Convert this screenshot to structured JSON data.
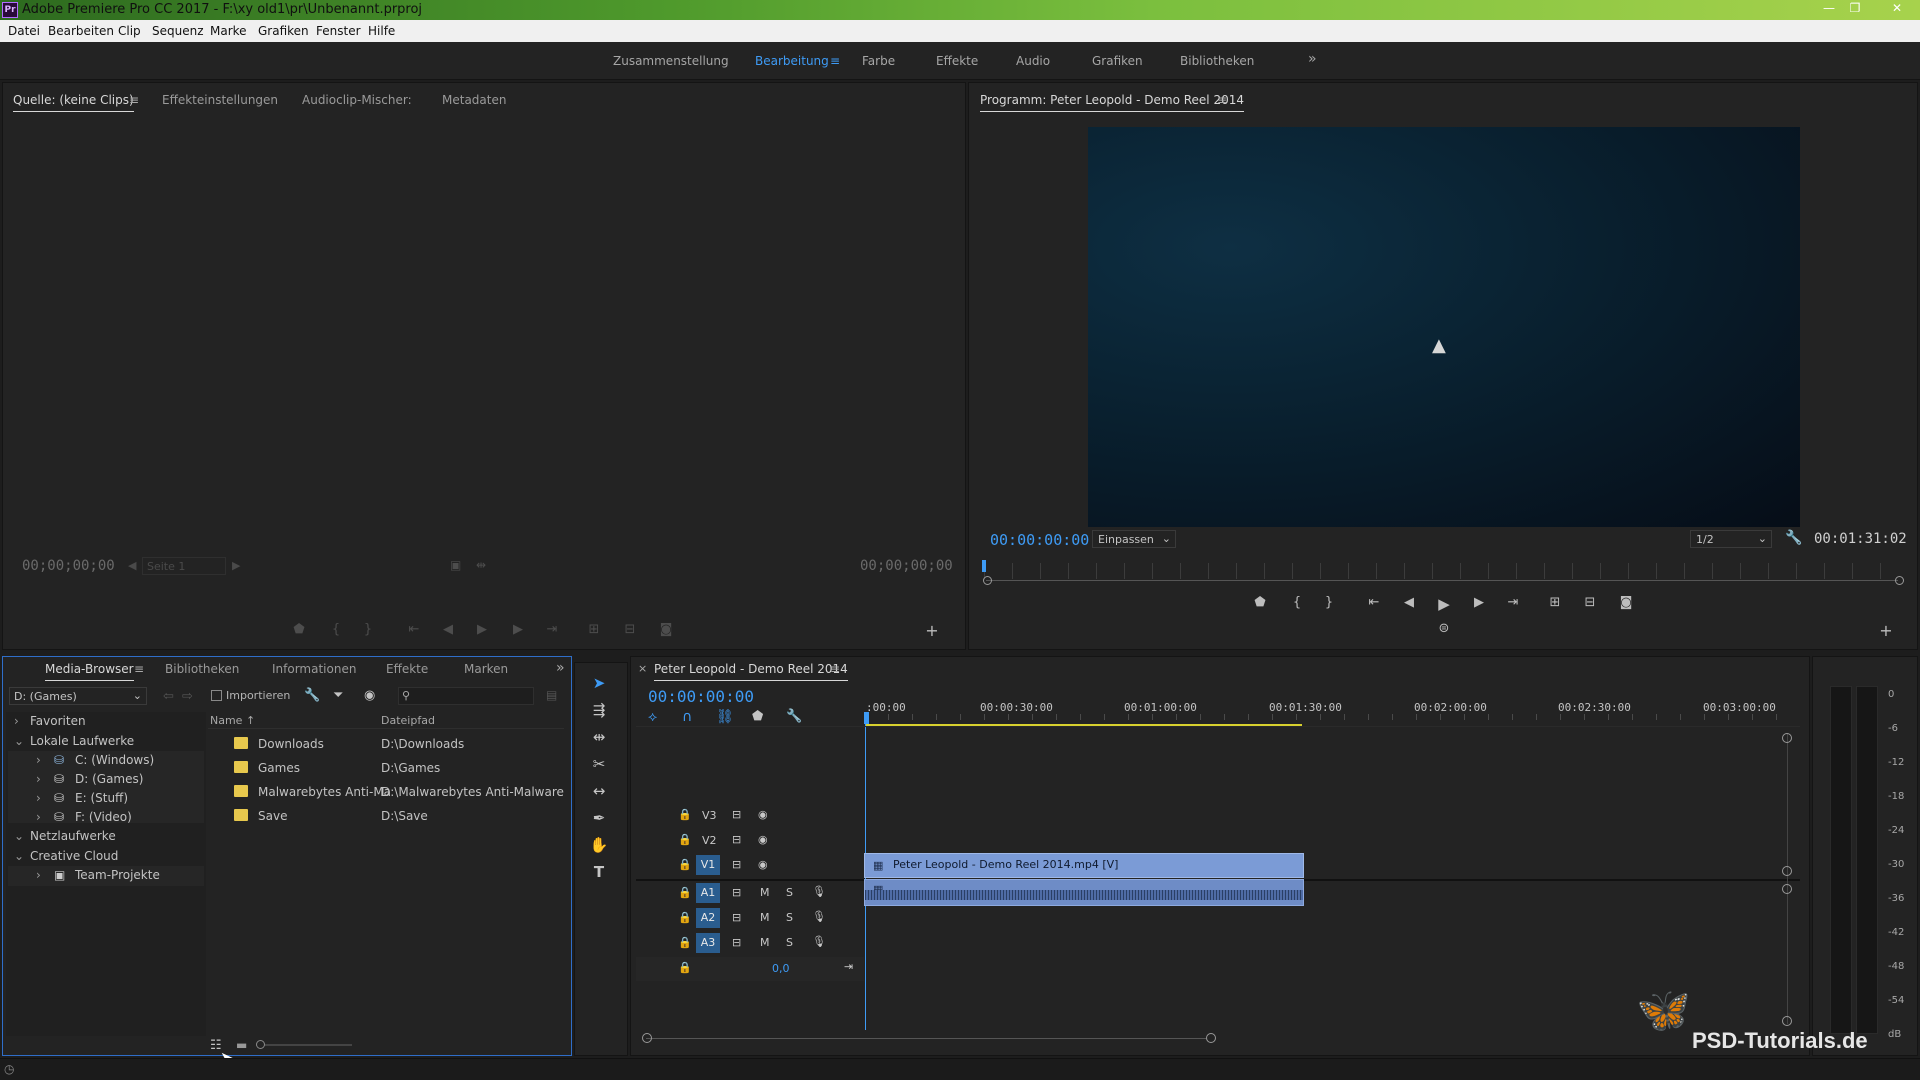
{
  "window": {
    "title": "Adobe Premiere Pro CC 2017 - F:\\xy old1\\pr\\Unbenannt.prproj",
    "app_badge": "Pr"
  },
  "menu": [
    "Datei",
    "Bearbeiten",
    "Clip",
    "Sequenz",
    "Marke",
    "Grafiken",
    "Fenster",
    "Hilfe"
  ],
  "workspaces": [
    "Zusammenstellung",
    "Bearbeitung",
    "Farbe",
    "Effekte",
    "Audio",
    "Grafiken",
    "Bibliotheken"
  ],
  "workspace_active": "Bearbeitung",
  "source": {
    "tabs": [
      "Quelle: (keine Clips)",
      "Effekteinstellungen",
      "Audioclip-Mischer:",
      "Metadaten"
    ],
    "timecode_left": "00;00;00;00",
    "timecode_right": "00;00;00;00",
    "page_select": "Seite 1"
  },
  "program": {
    "title": "Programm: Peter Leopold - Demo Reel 2014",
    "timecode": "00:00:00:00",
    "fit": "Einpassen",
    "resolution": "1/2",
    "duration": "00:01:31:02"
  },
  "media_browser": {
    "tabs": [
      "Media-Browser",
      "Bibliotheken",
      "Informationen",
      "Effekte",
      "Marken"
    ],
    "drive": "D: (Games)",
    "import_label": "Importieren",
    "col_name": "Name",
    "col_path": "Dateipfad",
    "tree": {
      "favorites": "Favoriten",
      "local": "Lokale Laufwerke",
      "drives": [
        "C: (Windows)",
        "D: (Games)",
        "E: (Stuff)",
        "F: (Video)"
      ],
      "network": "Netzlaufwerke",
      "cloud": "Creative Cloud",
      "team": "Team-Projekte"
    },
    "files": [
      {
        "name": "Downloads",
        "path": "D:\\Downloads"
      },
      {
        "name": "Games",
        "path": "D:\\Games"
      },
      {
        "name": "Malwarebytes Anti-Ma",
        "path": "D:\\Malwarebytes Anti-Malware"
      },
      {
        "name": "Save",
        "path": "D:\\Save"
      }
    ]
  },
  "timeline": {
    "sequence": "Peter Leopold - Demo Reel 2014",
    "timecode": "00:00:00:00",
    "ruler": [
      ":00:00",
      "00:00:30:00",
      "00:01:00:00",
      "00:01:30:00",
      "00:02:00:00",
      "00:02:30:00",
      "00:03:00:00"
    ],
    "video_tracks": [
      "V3",
      "V2",
      "V1"
    ],
    "audio_tracks": [
      "A1",
      "A2",
      "A3"
    ],
    "mute": "M",
    "solo": "S",
    "master_value": "0,0",
    "clip_name": "Peter Leopold - Demo Reel 2014.mp4 [V]"
  },
  "meter": [
    "0",
    "-6",
    "-12",
    "-18",
    "-24",
    "-30",
    "-36",
    "-42",
    "-48",
    "-54",
    "dB"
  ],
  "watermark": "PSD-Tutorials.de",
  "colors": {
    "accent": "#3e9bf5",
    "clip_video": "#7b9bd6",
    "clip_audio": "#6e8cc6",
    "folder": "#e7c84d",
    "work_area": "#d7d02e"
  }
}
